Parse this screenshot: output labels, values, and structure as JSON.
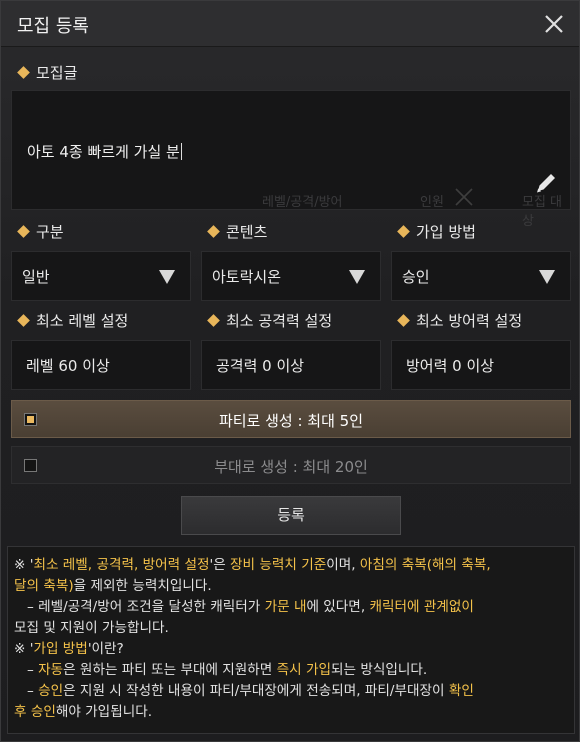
{
  "dialog": {
    "title": "모집 등록"
  },
  "post": {
    "label": "모집글",
    "text": "아토 4종 빠르게 가실 분",
    "ghost_labels": [
      "레벨/공격/방어",
      "인원",
      "모집 대상"
    ]
  },
  "selects": [
    {
      "label": "구분",
      "value": "일반"
    },
    {
      "label": "콘텐츠",
      "value": "아토락시온"
    },
    {
      "label": "가입 방법",
      "value": "승인"
    }
  ],
  "minimums": [
    {
      "label": "최소 레벨 설정",
      "value": "레벨  60 이상"
    },
    {
      "label": "최소 공격력 설정",
      "value": "공격력  0 이상"
    },
    {
      "label": "최소 방어력 설정",
      "value": "방어력  0 이상"
    }
  ],
  "options": {
    "party": {
      "label": "파티로 생성 : 최대 5인",
      "checked": true
    },
    "squad": {
      "label": "부대로 생성 : 최대 20인",
      "checked": false
    }
  },
  "register_label": "등록",
  "notes": {
    "n1a": "※ '",
    "n1b": "최소 레벨, 공격력, 방어력 설정",
    "n1c": "'은 ",
    "n1d": "장비 능력치 기준",
    "n1e": "이며, ",
    "n1f": "아침의 축복(해의 축복,",
    "n2a": "달의 축복)",
    "n2b": "을 제외한 능력치입니다.",
    "n3a": "   – 레벨/공격/방어 조건을 달성한 캐릭터가 ",
    "n3b": "가문 내",
    "n3c": "에 있다면, ",
    "n3d": "캐릭터에 관계없이",
    "n4": "모집 및 지원이 가능합니다.",
    "n5a": "※ '",
    "n5b": "가입 방법",
    "n5c": "'이란?",
    "n6a": "   – ",
    "n6b": "자동",
    "n6c": "은 원하는 파티 또는 부대에 지원하면 ",
    "n6d": "즉시 가입",
    "n6e": "되는 방식입니다.",
    "n7a": "   – ",
    "n7b": "승인",
    "n7c": "은 지원 시 작성한 내용이 파티/부대장에게 전송되며, 파티/부대장이 ",
    "n7d": "확인",
    "n8a": "후 승인",
    "n8b": "해야 가입됩니다."
  },
  "colors": {
    "accent_gold": "#e8b65a",
    "highlight_yellow": "#f4c24a"
  },
  "icons": [
    "close-icon",
    "pencil-icon",
    "dropdown-arrow-icon",
    "diamond-bullet-icon"
  ]
}
